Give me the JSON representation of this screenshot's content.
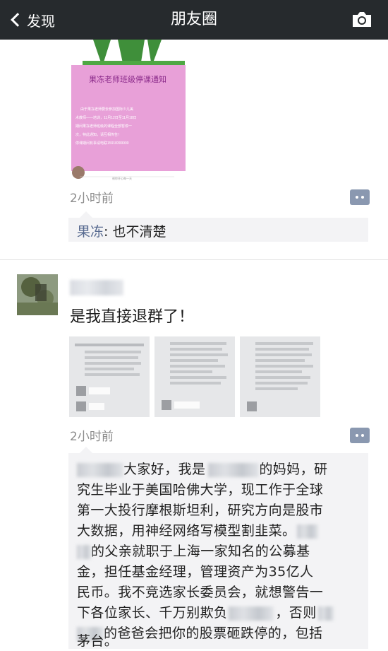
{
  "nav": {
    "back_label": "发现",
    "title": "朋友圈",
    "camera_icon": "camera-icon"
  },
  "post1": {
    "notice": {
      "title": "果冻老师班级停课通知",
      "body_lines": [
        "由于果冻老师要去参加国际少儿美",
        "术教师——培训，11月12日至11月18日",
        "期间果冻老师班级的课程全部暂停一",
        "次，特此通知，请互相传告！",
        "停课期间有事请电联15918399900"
      ],
      "footer": "祝你开心每一天"
    },
    "time": "2小时前",
    "comment": {
      "author": "果冻",
      "text": ": 也不清楚"
    }
  },
  "post2": {
    "text": "是我直接退群了！",
    "time": "2小时前",
    "comment_lines": [
      "大家好，我是",
      "的妈妈，研",
      "究生毕业于美国哈佛大学，现工作于全球",
      "第一大投行摩根斯坦利，研究方向是股市",
      "大数据，用神经网络写模型割韭菜。",
      "的父亲就职于上海一家知名的公募基",
      "金，担任基金经理，管理资产为35亿人",
      "民币。我不竞选家长委员会，就想警告一",
      "下各位家长、千万别欺负",
      "，否则",
      "的爸爸会把你的股票砸跌停的，包括",
      "茅台。"
    ]
  },
  "colors": {
    "nav_bg": "#262a2d",
    "link": "#56698f",
    "comment_bg": "#f3f3f5",
    "notice_pink": "#e8a0d8"
  }
}
